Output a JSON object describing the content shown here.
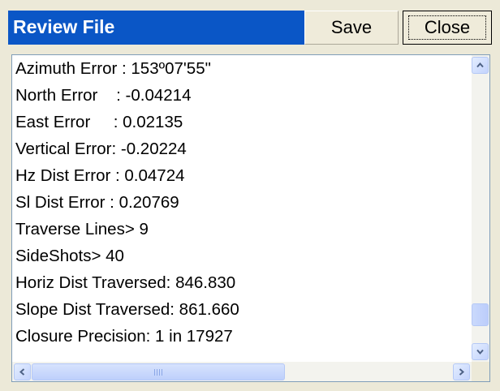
{
  "window": {
    "title": "Review File"
  },
  "toolbar": {
    "save_label": "Save",
    "close_label": "Close"
  },
  "review_lines": [
    "Azimuth Error : 153º07'55\"",
    "North Error    : -0.04214",
    "East Error     : 0.02135",
    "Vertical Error: -0.20224",
    "Hz Dist Error : 0.04724",
    "Sl Dist Error : 0.20769",
    "Traverse Lines> 9",
    "SideShots> 40",
    "Horiz Dist Traversed: 846.830",
    "Slope Dist Traversed: 861.660",
    "Closure Precision: 1 in 17927"
  ],
  "colors": {
    "title_bar": "#0A56C6",
    "window_bg": "#ECE9D8",
    "scrollbar_accent": "#C3D3FD"
  },
  "icons": {
    "scroll_up": "chevron-up-icon",
    "scroll_down": "chevron-down-icon",
    "scroll_left": "chevron-left-icon",
    "scroll_right": "chevron-right-icon"
  }
}
